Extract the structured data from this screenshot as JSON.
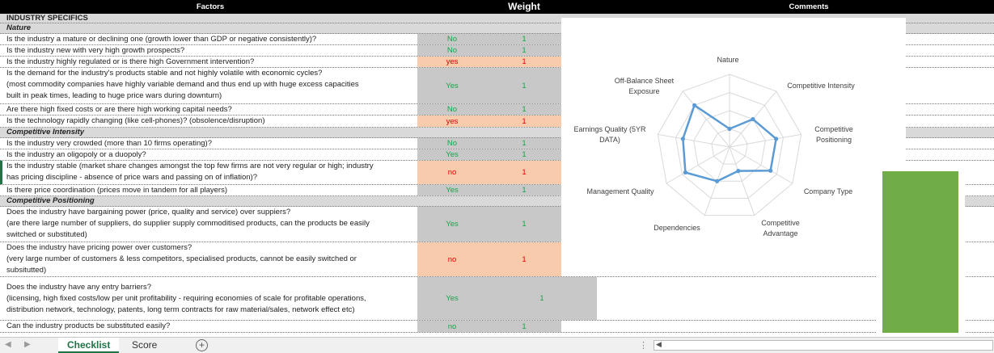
{
  "header": {
    "factors": "Factors",
    "weight": "Weight",
    "comments": "Comments"
  },
  "sheet_rows": {
    "r0": {
      "q": "INDUSTRY SPECIFICS"
    },
    "r1": {
      "q": "Nature"
    },
    "r2": {
      "q": "Is the industry a mature or declining one (growth lower than GDP or negative consistently)?",
      "a": "No",
      "w": "1"
    },
    "r3": {
      "q": "Is the industry new with very high growth prospects?",
      "a": "No",
      "w": "1"
    },
    "r4": {
      "q": "Is the industry highly regulated or is there high Government intervention?",
      "a": "yes",
      "w": "1"
    },
    "r5": {
      "q1": "Is the demand for the industry's products stable and not highly volatile with economic cycles?",
      "q2": "(most commodity companies have highly variable demand and thus end up with huge excess capacities",
      "q3": "built in peak times, leading to huge price wars during downturn)",
      "a": "Yes",
      "w": "1"
    },
    "r6": {
      "q": "Are there high fixed costs or are there high working capital needs?",
      "a": "No",
      "w": "1"
    },
    "r7": {
      "q": "Is the technology rapidly changing (like cell-phones)? (obsolence/disruption)",
      "a": "yes",
      "w": "1"
    },
    "r8": {
      "q": "Competitive Intensity"
    },
    "r9": {
      "q": "Is the industry very crowded (more than 10 firms operating)?",
      "a": "No",
      "w": "1"
    },
    "r10": {
      "q": "Is the industry an oligopoly or a duopoly?",
      "a": "Yes",
      "w": "1"
    },
    "r11": {
      "q1": "Is the industry stable (market share changes amongst the top few firms are not very regular or high; industry",
      "q2": "has pricing discipline - absence of price wars and passing on of inflation)?",
      "a": "no",
      "w": "1"
    },
    "r12": {
      "q": "Is there price coordination (prices move in tandem for all players)",
      "a": "Yes",
      "w": "1"
    },
    "r13": {
      "q": "Competitive Positioning"
    },
    "r14": {
      "q1": "Does the industry have bargaining power (price, quality and service) over suppiers?",
      "q2": "(are there large number of suppliers, do supplier supply commoditised products, can the products be easily",
      "q3": "switched or substituted)",
      "a": "Yes",
      "w": "1"
    },
    "r15": {
      "q1": "Does the industry have pricing power over customers?",
      "q2": "(very large number of customers & less competitors, specialised products, cannot be easily switched or",
      "q3": "subsitutted)",
      "a": "no",
      "w": "1"
    },
    "r16": {
      "q1": "Does the industry have any entry barriers?",
      "q2": "(licensing, high fixed costs/low per unit profitability - requiring economies of scale for profitable operations,",
      "q3": "distribution network, technology, patents, long term contracts for raw material/sales, network effect etc)",
      "a": "Yes",
      "w": "1"
    },
    "r17": {
      "q": "Can the industry products be substituted easily?",
      "a": "no",
      "w": "1"
    }
  },
  "radar_chart": {
    "axes": [
      "Nature",
      "Competitive Intensity",
      "Competitive Positioning",
      "Company Type",
      "Competitive Advantage",
      "Dependencies",
      "Management Quality",
      "Earnings Quality (5YR DATA)",
      "Off-Balance Sheet Exposure"
    ],
    "labels": {
      "l0": "Nature",
      "l1": "Competitive Intensity",
      "l2a": "Competitive",
      "l2b": "Positioning",
      "l3": "Company Type",
      "l4a": "Competitive",
      "l4b": "Advantage",
      "l5": "Dependencies",
      "l6": "Management Quality",
      "l7a": "Earnings Quality (5YR",
      "l7b": "DATA)",
      "l8a": "Off-Balance Sheet",
      "l8b": "Exposure"
    },
    "values": [
      0.25,
      0.5,
      0.65,
      0.65,
      0.35,
      0.5,
      0.7,
      0.65,
      0.75
    ],
    "rings": 4,
    "series_color": "#5b9bd5",
    "grid_color": "#d9d9d9"
  },
  "bar_widget": {
    "fill_fraction": 1.0,
    "color": "#70ad47"
  },
  "tabs": {
    "active": "Checklist",
    "other": "Score",
    "add": "+"
  },
  "colors": {
    "answer_green": "#1aa34a",
    "answer_red": "#e00000",
    "peach": "#f8cbad",
    "grey": "#c8c8c8",
    "excel_green": "#217346"
  }
}
